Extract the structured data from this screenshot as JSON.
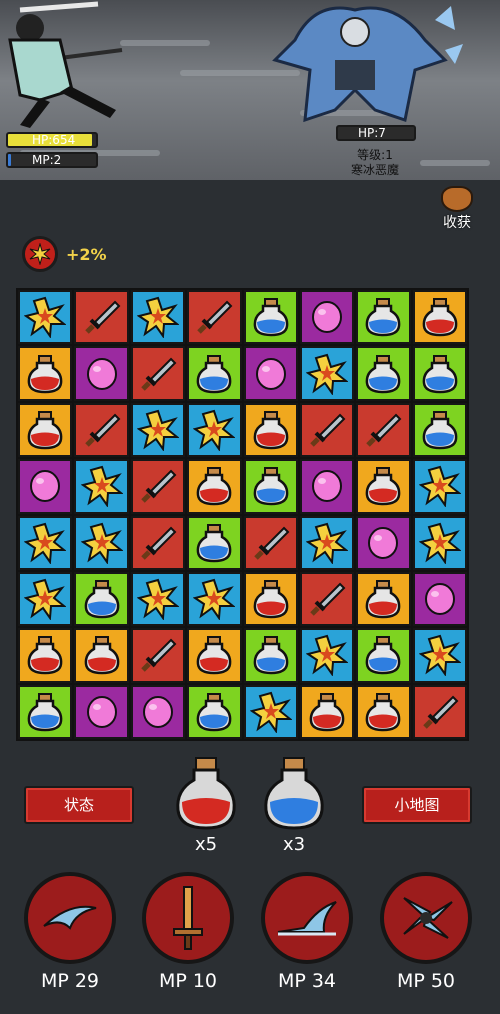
{
  "hero": {
    "hp_label": "HP:654",
    "mp_label": "MP:2",
    "hp_fraction": 0.95,
    "mp_fraction": 0.03
  },
  "enemy": {
    "hp_label": "HP:7",
    "level_label": "等级:1",
    "name": "寒冰恶魔"
  },
  "harvest_label": "收获",
  "buff": {
    "label": "+2%",
    "icon": "explosion-icon"
  },
  "colors": {
    "star": "#2aa3d8",
    "sword": "#c93a2e",
    "potion": "#f0a81e",
    "blue_potion": "#7ed321",
    "pink": "#9b2aa0"
  },
  "board": [
    [
      "star",
      "sword",
      "star",
      "sword",
      "blue",
      "pink",
      "blue",
      "potion"
    ],
    [
      "potion",
      "pink",
      "sword",
      "blue",
      "pink",
      "star",
      "blue",
      "blue"
    ],
    [
      "potion",
      "sword",
      "star",
      "star",
      "potion",
      "sword",
      "sword",
      "blue"
    ],
    [
      "pink",
      "star",
      "sword",
      "potion",
      "blue",
      "pink",
      "potion",
      "star"
    ],
    [
      "star",
      "star",
      "sword",
      "blue",
      "sword",
      "star",
      "pink",
      "star"
    ],
    [
      "star",
      "blue",
      "star",
      "star",
      "potion",
      "sword",
      "potion",
      "pink"
    ],
    [
      "potion",
      "potion",
      "sword",
      "potion",
      "blue",
      "star",
      "blue",
      "star"
    ],
    [
      "blue",
      "pink",
      "pink",
      "blue",
      "star",
      "potion",
      "potion",
      "sword"
    ]
  ],
  "buttons": {
    "status": "状态",
    "minimap": "小地图"
  },
  "flasks": [
    {
      "color": "red",
      "count": "x5"
    },
    {
      "color": "blue",
      "count": "x3"
    }
  ],
  "skills": [
    {
      "icon": "wind-slash-icon",
      "mp": "MP 29"
    },
    {
      "icon": "sword-icon",
      "mp": "MP 10"
    },
    {
      "icon": "wave-icon",
      "mp": "MP 34"
    },
    {
      "icon": "burst-icon",
      "mp": "MP 50"
    }
  ]
}
